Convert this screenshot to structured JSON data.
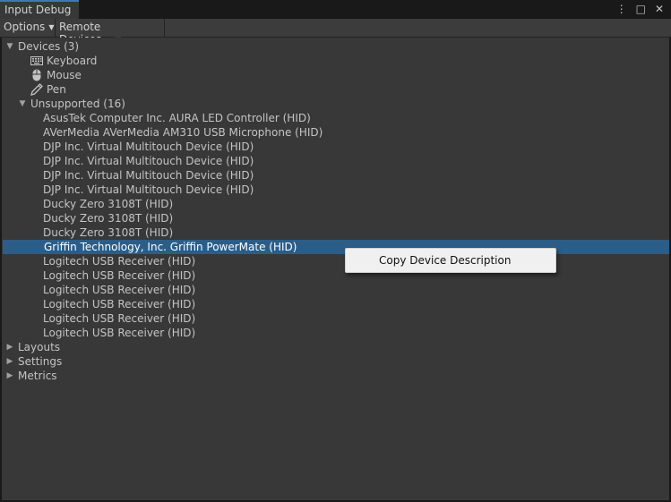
{
  "window": {
    "tab_title": "Input Debug",
    "icons": [
      "kebab-menu-icon",
      "maximize-icon",
      "close-icon"
    ]
  },
  "toolbar": {
    "options_label": "Options",
    "remote_label": "Remote Devices..."
  },
  "tree": {
    "devices_label": "Devices (3)",
    "devices": [
      {
        "label": "Keyboard",
        "icon": "keyboard-icon"
      },
      {
        "label": "Mouse",
        "icon": "mouse-icon"
      },
      {
        "label": "Pen",
        "icon": "pen-icon"
      }
    ],
    "unsupported_label": "Unsupported (16)",
    "unsupported": [
      "AsusTek Computer Inc. AURA LED Controller (HID)",
      "AVerMedia AVerMedia AM310 USB Microphone (HID)",
      "DJP Inc. Virtual Multitouch Device (HID)",
      "DJP Inc. Virtual Multitouch Device (HID)",
      "DJP Inc. Virtual Multitouch Device (HID)",
      "DJP Inc. Virtual Multitouch Device (HID)",
      "Ducky Zero 3108T (HID)",
      "Ducky Zero 3108T (HID)",
      "Ducky Zero 3108T (HID)",
      "Griffin Technology, Inc. Griffin PowerMate (HID)",
      "Logitech USB Receiver (HID)",
      "Logitech USB Receiver (HID)",
      "Logitech USB Receiver (HID)",
      "Logitech USB Receiver (HID)",
      "Logitech USB Receiver (HID)",
      "Logitech USB Receiver (HID)"
    ],
    "selected_unsupported_index": 9,
    "sections": [
      "Layouts",
      "Settings",
      "Metrics"
    ]
  },
  "context_menu": {
    "items": [
      "Copy Device Description"
    ]
  },
  "colors": {
    "selection": "#2c5d87",
    "tab_accent": "#3a79bb"
  }
}
